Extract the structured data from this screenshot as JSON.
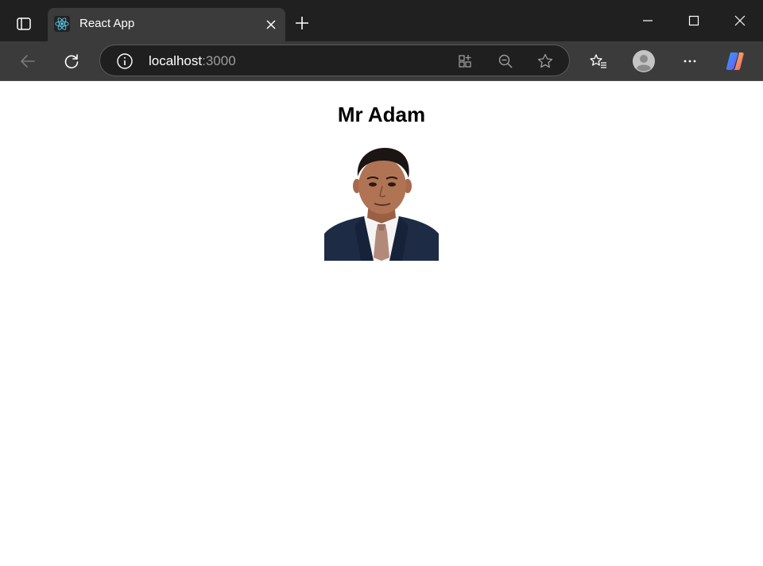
{
  "browser": {
    "tab": {
      "title": "React App"
    },
    "address": {
      "host": "localhost",
      "port": ":3000"
    }
  },
  "page": {
    "heading": "Mr Adam",
    "photo_alt": "profile photo of a man in a dark suit and tie"
  },
  "colors": {
    "tabstrip_bg": "#202020",
    "toolbar_bg": "#3b3b3b",
    "page_bg": "#ffffff"
  }
}
